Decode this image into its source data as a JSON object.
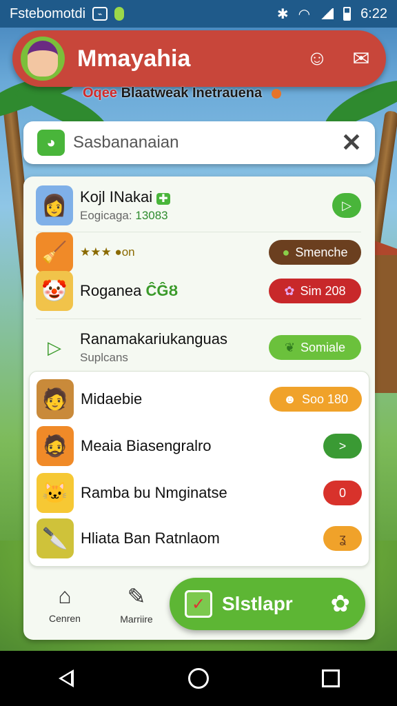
{
  "status_bar": {
    "left_text": "Fstebomotdi",
    "box_glyph": "⌁",
    "time": "6:22"
  },
  "header": {
    "app_title": "Mmayahia",
    "subtitle_red": "Oqee",
    "subtitle_dark": "Blaatweak Inetrauena"
  },
  "search": {
    "value": "Sasbananaian",
    "close_glyph": "✕"
  },
  "rows": [
    {
      "title": "Kojl INakai",
      "badge": "✚",
      "sub_prefix": "Eogicaga:",
      "sub_value": "13083",
      "pill_label": "",
      "pill_glyph": "▷",
      "pill_color": "#49b53a"
    },
    {
      "title": "★★★ ●on",
      "pill_label": "Smenche",
      "pill_glyph": "●",
      "pill_color": "#6b3f1f"
    },
    {
      "title": "Roganea",
      "title_green": "ĈĜȢ",
      "pill_label": "Sim 208",
      "pill_glyph": "✿",
      "pill_color": "#c8282a"
    },
    {
      "title": "Ranamakariukanguas",
      "sub": "Suplcans",
      "pill_label": "Somiale",
      "pill_glyph": "❦",
      "pill_color": "#6bc13c"
    },
    {
      "title": "Midaebie",
      "pill_label": "Soo 180",
      "pill_glyph": "☻",
      "pill_color": "#f0a22a"
    },
    {
      "title": "Meaia Biasengralro",
      "pill_label": "",
      "pill_glyph": ">",
      "pill_color": "#3a9a34"
    },
    {
      "title": "Ramba bu Nmginatse",
      "pill_label": "",
      "pill_glyph": "0",
      "pill_color": "#d8322b"
    },
    {
      "title": "Hliata Ban Ratnlaom",
      "pill_label": "",
      "pill_glyph": "ʓ",
      "pill_color": "#f0a22a"
    }
  ],
  "bottom_nav": {
    "home_label": "Cenren",
    "market_label": "Marriire"
  },
  "cta": {
    "label": "Slstlapr"
  },
  "colors": {
    "header_red": "#c8463a",
    "accent_green": "#5db634",
    "status_blue": "#1f5a8a"
  }
}
